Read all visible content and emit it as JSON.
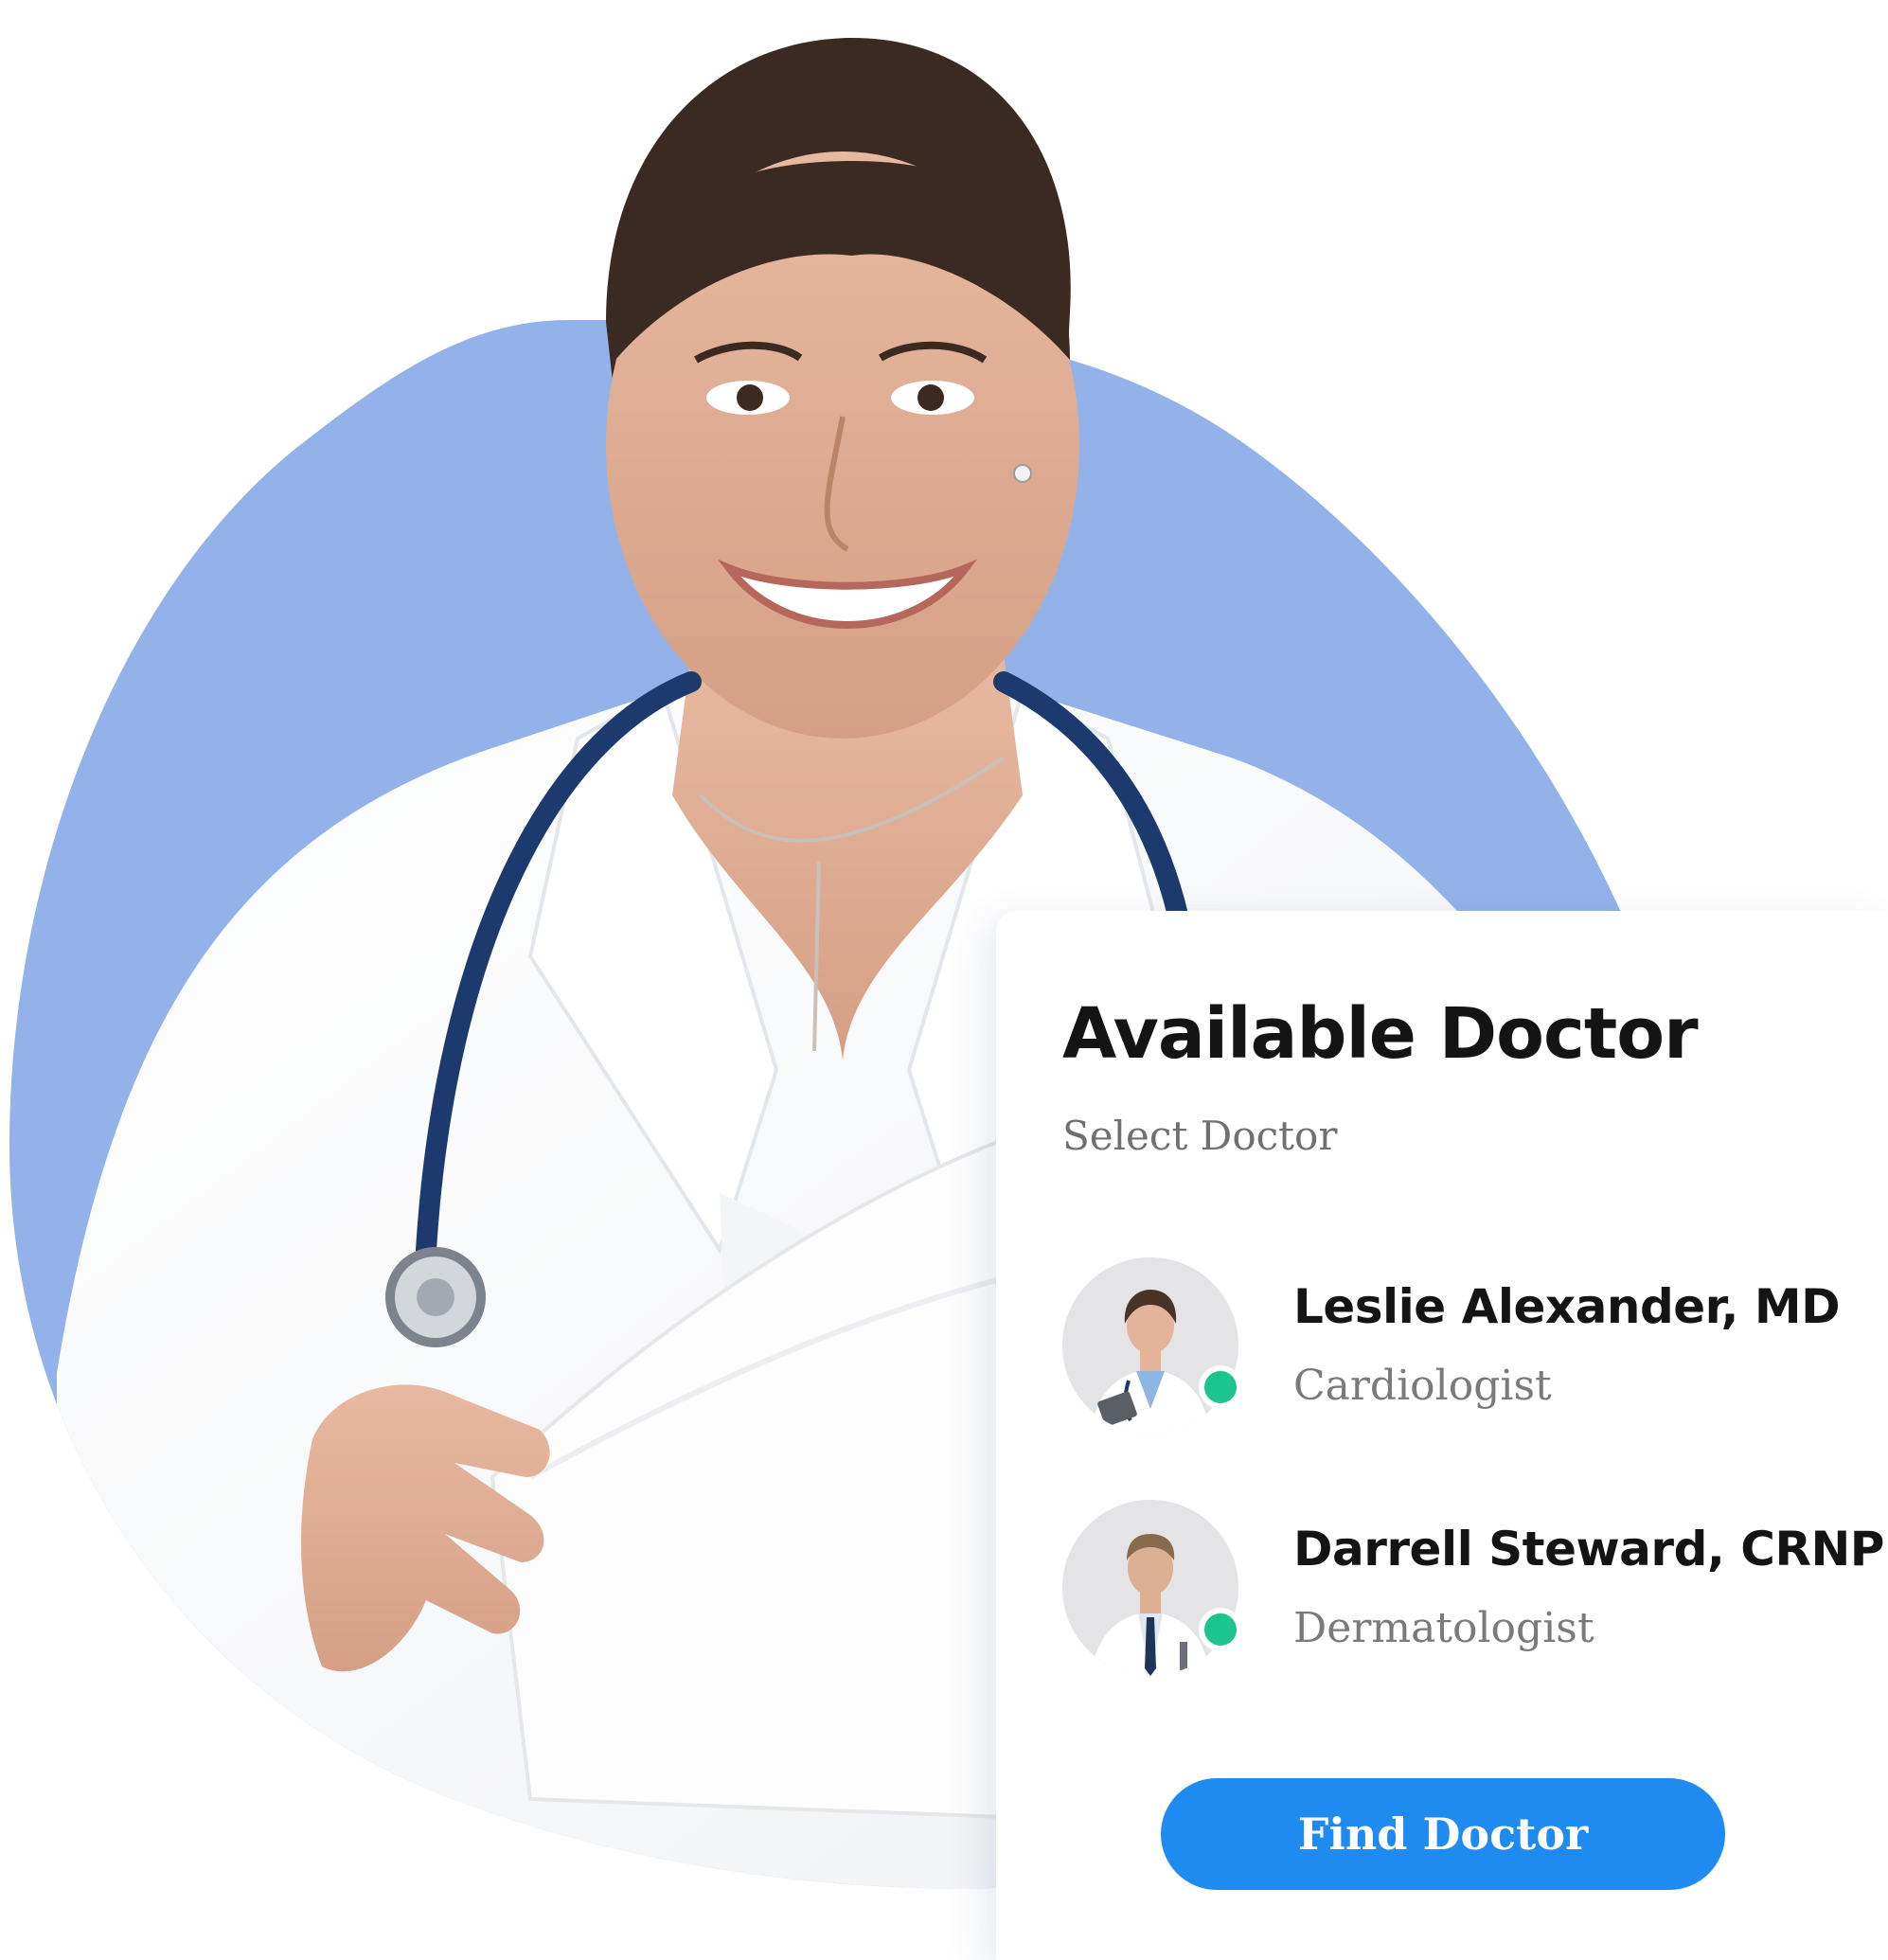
{
  "hero": {
    "photo": "doctor-portrait-photo",
    "blob_color": "#93b2ea"
  },
  "card": {
    "title": "Available Doctor",
    "subtitle": "Select Doctor",
    "doctors": [
      {
        "name": "Leslie Alexander, MD",
        "specialty": "Cardiologist",
        "status": "online"
      },
      {
        "name": "Darrell Steward, CRNP",
        "specialty": "Dermatologist",
        "status": "online"
      }
    ],
    "button_label": "Find Doctor",
    "accent_color": "#1f8bf0",
    "online_color": "#1ec48e"
  }
}
